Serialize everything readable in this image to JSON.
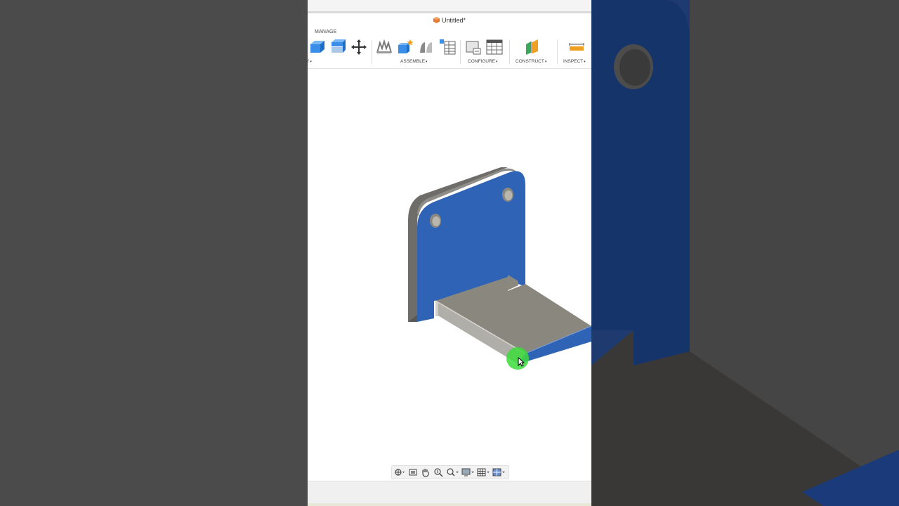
{
  "window": {
    "title": "Untitled*"
  },
  "toolbar": {
    "active_tab": "MANAGE",
    "groups": {
      "modify_partial": "Y",
      "assemble": "ASSEMBLE",
      "configure": "CONFIGURE",
      "construct": "CONSTRUCT",
      "inspect": "INSPECT"
    },
    "caret": "▾"
  },
  "icons": {
    "doc": "document-cube-icon",
    "cursor": "mouse-cursor-icon"
  },
  "colors": {
    "face_blue": "#2f63b5",
    "face_gray": "#8b8880",
    "edge_gray": "#6f6d69",
    "highlight_green": "#3cdc3c",
    "doc_orange": "#e8792a"
  }
}
